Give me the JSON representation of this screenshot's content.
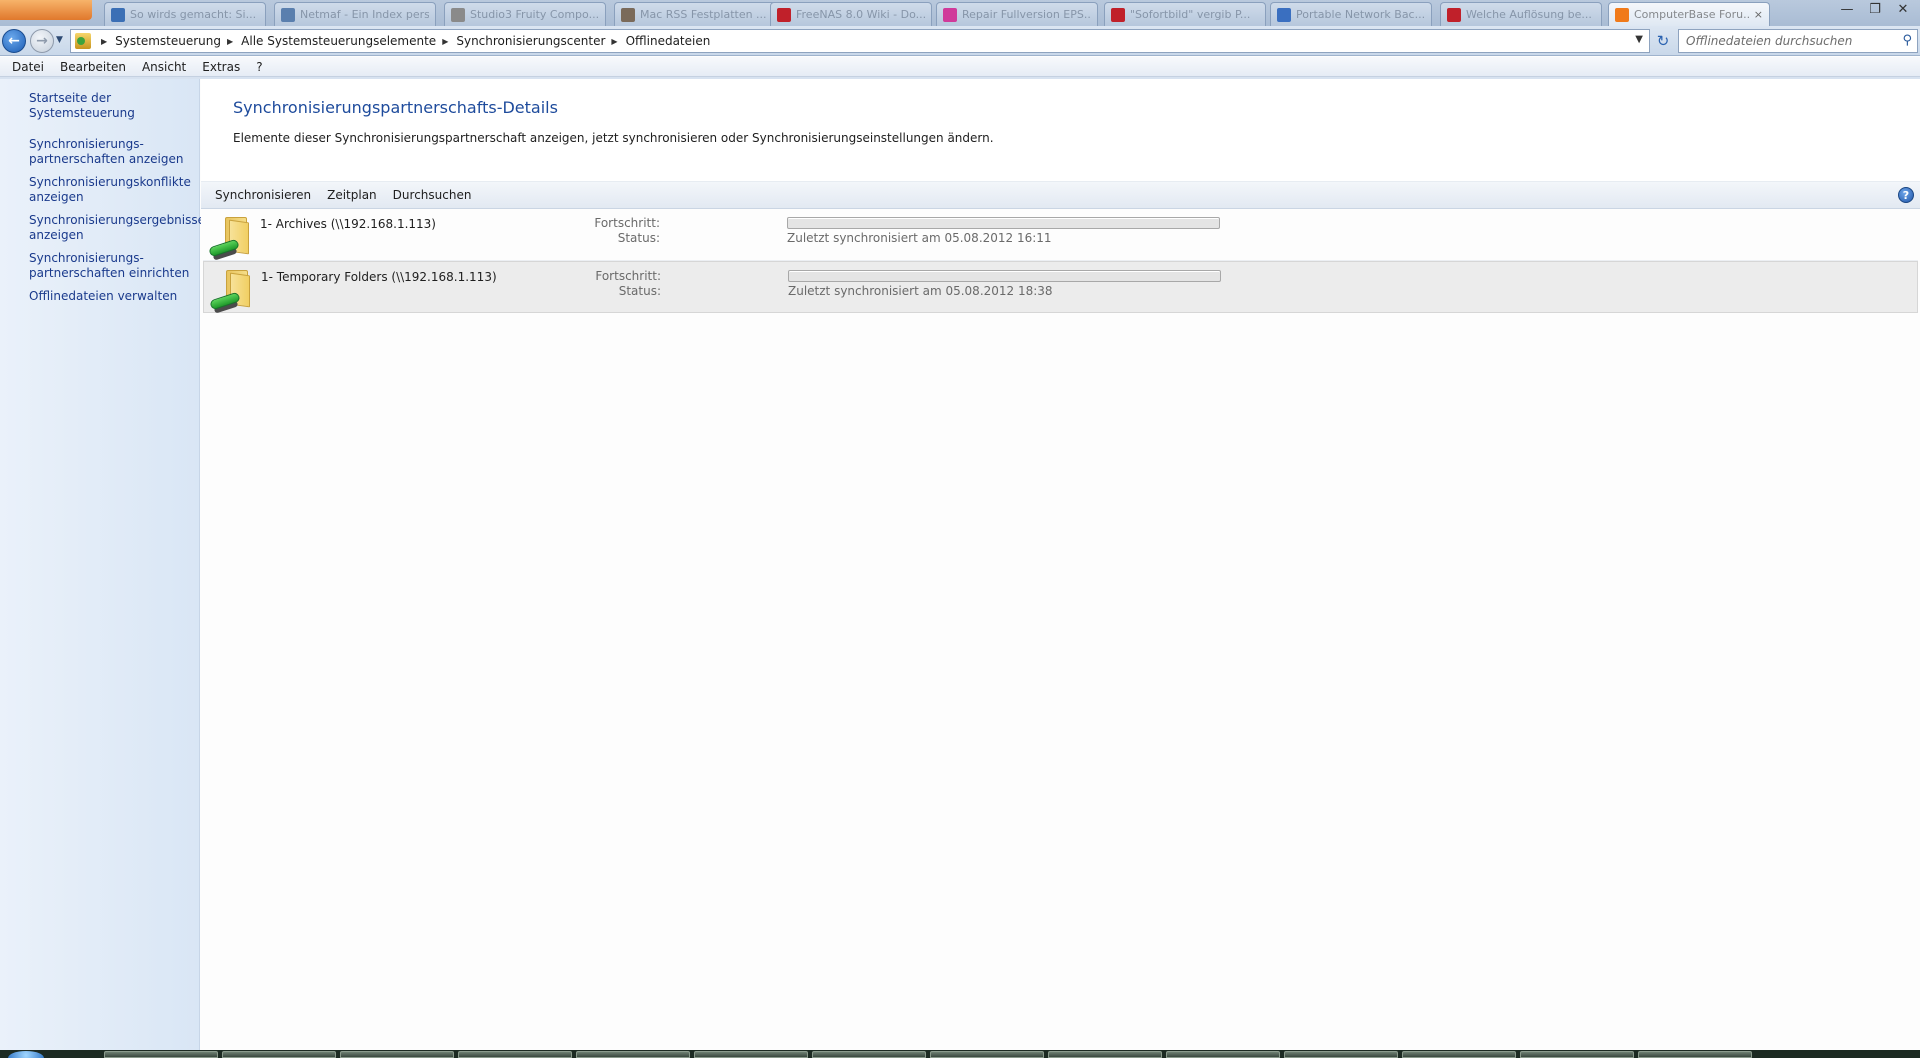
{
  "browser_tabs": [
    {
      "title": "So wirds gemacht: Si...",
      "active": false
    },
    {
      "title": "Netmaf - Ein Index pers...",
      "active": false
    },
    {
      "title": "Studio3 Fruity Compo...",
      "active": false
    },
    {
      "title": "Mac RSS Festplatten ...",
      "active": false
    },
    {
      "title": "FreeNAS 8.0 Wiki - Do...",
      "active": false
    },
    {
      "title": "Repair Fullversion EPS...",
      "active": false
    },
    {
      "title": "\"Sofortbild\" vergib P...",
      "active": false
    },
    {
      "title": "Portable Network Bac...",
      "active": false
    },
    {
      "title": "Welche Auflösung be...",
      "active": false
    },
    {
      "title": "ComputerBase Foru...",
      "active": true
    }
  ],
  "window_controls": {
    "minimize": "—",
    "maximize": "❐",
    "close": "✕"
  },
  "breadcrumb": [
    "Systemsteuerung",
    "Alle Systemsteuerungselemente",
    "Synchronisierungscenter",
    "Offlinedateien"
  ],
  "search": {
    "placeholder": "Offlinedateien durchsuchen"
  },
  "menu": [
    "Datei",
    "Bearbeiten",
    "Ansicht",
    "Extras",
    "?"
  ],
  "sidebar": {
    "home": "Startseite der Systemsteuerung",
    "tasks": [
      {
        "line1": "Synchronisierungs-",
        "line2": "partnerschaften anzeigen"
      },
      {
        "line1": "Synchronisierungskonflikte",
        "line2": "anzeigen"
      },
      {
        "line1": "Synchronisierungsergebnisse",
        "line2": "anzeigen"
      },
      {
        "line1": "Synchronisierungs-",
        "line2": "partnerschaften einrichten"
      },
      {
        "line1": "Offlinedateien verwalten",
        "line2": ""
      }
    ]
  },
  "main": {
    "title": "Synchronisierungspartnerschafts-Details",
    "description": "Elemente dieser Synchronisierungspartnerschaft anzeigen, jetzt synchronisieren oder Synchronisierungseinstellungen ändern.",
    "commands": [
      "Synchronisieren",
      "Zeitplan",
      "Durchsuchen"
    ],
    "help": "?",
    "progress_label": "Fortschritt:",
    "status_label": "Status:",
    "items": [
      {
        "name": "1- Archives (\\\\192.168.1.113)",
        "status": "Zuletzt synchronisiert am 05.08.2012 16:11",
        "progress": 0,
        "selected": false
      },
      {
        "name": "1- Temporary Folders (\\\\192.168.1.113)",
        "status": "Zuletzt synchronisiert am 05.08.2012 18:38",
        "progress": 0,
        "selected": true
      }
    ]
  },
  "icons": {
    "back": "back-arrow-icon",
    "forward": "forward-arrow-icon",
    "refresh": "refresh-icon",
    "search": "search-icon",
    "help": "help-icon",
    "folder": "sync-folder-icon"
  }
}
